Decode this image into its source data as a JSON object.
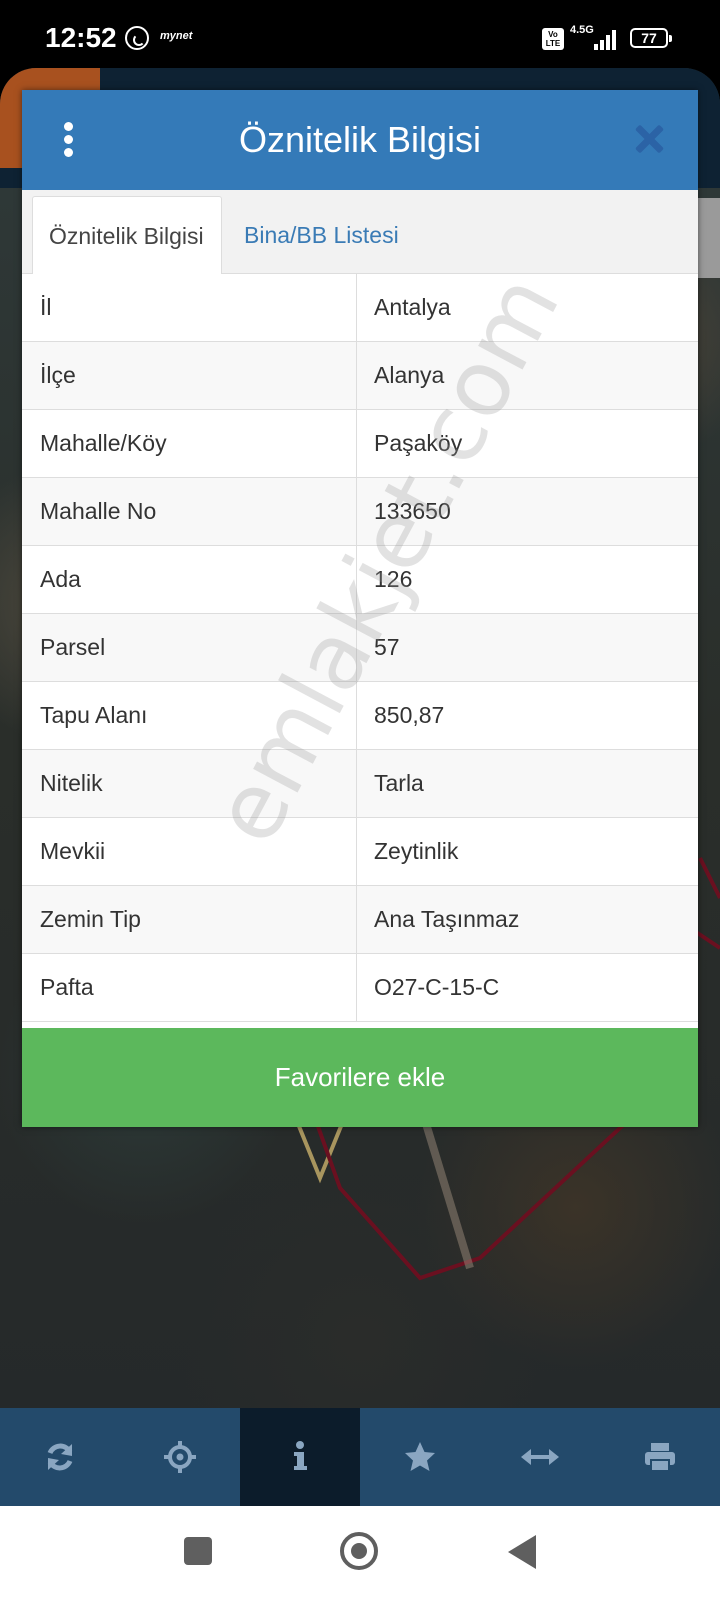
{
  "status_bar": {
    "time": "12:52",
    "carrier": "mynet",
    "volte": "Vo LTE",
    "network": "4.5G",
    "battery": "77"
  },
  "dialog": {
    "title": "Öznitelik Bilgisi",
    "tabs": [
      {
        "label": "Öznitelik Bilgisi",
        "active": true
      },
      {
        "label": "Bina/BB Listesi",
        "active": false
      }
    ],
    "rows": [
      {
        "label": "İl",
        "value": "Antalya"
      },
      {
        "label": "İlçe",
        "value": "Alanya"
      },
      {
        "label": "Mahalle/Köy",
        "value": "Paşaköy"
      },
      {
        "label": "Mahalle No",
        "value": "133650"
      },
      {
        "label": "Ada",
        "value": "126"
      },
      {
        "label": "Parsel",
        "value": "57"
      },
      {
        "label": "Tapu Alanı",
        "value": "850,87"
      },
      {
        "label": "Nitelik",
        "value": "Tarla"
      },
      {
        "label": "Mevkii",
        "value": "Zeytinlik"
      },
      {
        "label": "Zemin Tip",
        "value": "Ana Taşınmaz"
      },
      {
        "label": "Pafta",
        "value": "O27-C-15-C"
      }
    ],
    "favorite_button": "Favorilere ekle"
  },
  "watermark": "emlakjet.com",
  "toolbar": {
    "items": [
      "refresh-icon",
      "locate-icon",
      "info-icon",
      "star-icon",
      "measure-icon",
      "print-icon"
    ],
    "active": "info-icon"
  },
  "colors": {
    "header": "#347ab8",
    "button": "#5cb85c",
    "toolbar": "#234a6b",
    "tab_link": "#3a7bb5"
  }
}
